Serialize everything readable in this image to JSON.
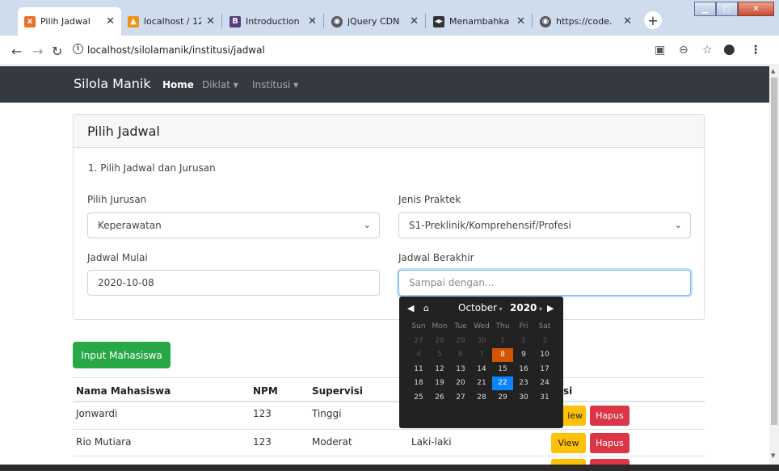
{
  "browser": {
    "tabs": [
      {
        "title": "Pilih Jadwal",
        "icon": "xampp-icon",
        "color": "#e8702a"
      },
      {
        "title": "localhost / 12",
        "icon": "phpmyadmin-icon",
        "color": "#f29111"
      },
      {
        "title": "Introduction",
        "icon": "bootstrap-icon",
        "color": "#563d7c"
      },
      {
        "title": "jQuery CDN",
        "icon": "globe-icon",
        "color": "#555555"
      },
      {
        "title": "Menambahka",
        "icon": "arrows-icon",
        "color": "#333333"
      },
      {
        "title": "https://code.",
        "icon": "globe-icon",
        "color": "#555555"
      }
    ],
    "url": "localhost/silolamanik/institusi/jadwal"
  },
  "navbar": {
    "brand": "Silola Manik",
    "home": "Home",
    "diklat": "Diklat",
    "institusi": "Institusi"
  },
  "card": {
    "title": "Pilih Jadwal",
    "subtitle": "1. Pilih Jadwal dan Jurusan",
    "jurusan_label": "Pilih Jurusan",
    "jurusan_value": "Keperawatan",
    "praktek_label": "Jenis Praktek",
    "praktek_value": "S1-Preklinik/Komprehensif/Profesi",
    "mulai_label": "Jadwal Mulai",
    "mulai_value": "2020-10-08",
    "berakhir_label": "Jadwal Berakhir",
    "berakhir_placeholder": "Sampai dengan..."
  },
  "input_button": "Input Mahasiswa",
  "table": {
    "headers": [
      "Nama Mahasiswa",
      "NPM",
      "Supervisi",
      "Aksi"
    ],
    "aksi_visible": "si",
    "rows": [
      {
        "nama": "Jonwardi",
        "npm": "123",
        "supervisi": "Tinggi",
        "gender": ""
      },
      {
        "nama": "Rio Mutiara",
        "npm": "123",
        "supervisi": "Moderat",
        "gender": "Laki-laki"
      }
    ],
    "view_label": "View",
    "view_label_clipped": "iew",
    "delete_label": "Hapus"
  },
  "datepicker": {
    "month": "October",
    "year": "2020",
    "days_of_week": [
      "Sun",
      "Mon",
      "Tue",
      "Wed",
      "Thu",
      "Fri",
      "Sat"
    ],
    "weeks": [
      [
        "27",
        "28",
        "29",
        "30",
        "1",
        "2",
        "3"
      ],
      [
        "4",
        "5",
        "6",
        "7",
        "8",
        "9",
        "10"
      ],
      [
        "11",
        "12",
        "13",
        "14",
        "15",
        "16",
        "17"
      ],
      [
        "18",
        "19",
        "20",
        "21",
        "22",
        "23",
        "24"
      ],
      [
        "25",
        "26",
        "27",
        "28",
        "29",
        "30",
        "31"
      ]
    ],
    "selected": "8",
    "today": "22"
  }
}
